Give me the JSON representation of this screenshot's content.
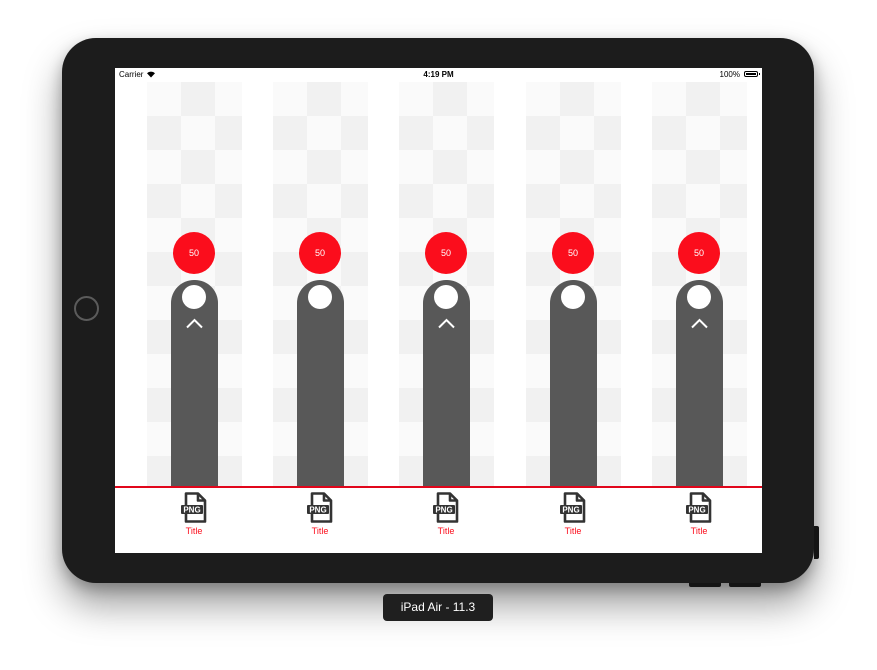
{
  "status_bar": {
    "carrier": "Carrier",
    "time": "4:19 PM",
    "battery": "100%"
  },
  "sliders": [
    {
      "value": "50",
      "show_chevron": true
    },
    {
      "value": "50",
      "show_chevron": false
    },
    {
      "value": "50",
      "show_chevron": true
    },
    {
      "value": "50",
      "show_chevron": false
    },
    {
      "value": "50",
      "show_chevron": true
    }
  ],
  "tabs": [
    {
      "label": "Title",
      "icon": "png-file-icon"
    },
    {
      "label": "Title",
      "icon": "png-file-icon"
    },
    {
      "label": "Title",
      "icon": "png-file-icon"
    },
    {
      "label": "Title",
      "icon": "png-file-icon"
    },
    {
      "label": "Title",
      "icon": "png-file-icon"
    }
  ],
  "simulator": {
    "device_label": "iPad Air - 11.3"
  },
  "colors": {
    "accent": "#fb0d1c",
    "track": "#585858",
    "divider": "#e1061b"
  }
}
